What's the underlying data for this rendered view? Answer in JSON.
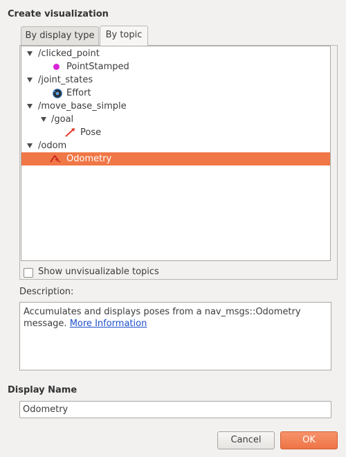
{
  "dialog": {
    "title": "Create visualization"
  },
  "tabs": [
    {
      "label": "By display type",
      "active": false
    },
    {
      "label": "By topic",
      "active": true
    }
  ],
  "tree": {
    "items": [
      {
        "label": "/clicked_point"
      },
      {
        "label": "PointStamped",
        "icon": "magenta-dot-icon"
      },
      {
        "label": "/joint_states"
      },
      {
        "label": "Effort",
        "icon": "effort-gauge-icon"
      },
      {
        "label": "/move_base_simple"
      },
      {
        "label": "/goal"
      },
      {
        "label": "Pose",
        "icon": "pose-arrow-icon"
      },
      {
        "label": "/odom"
      },
      {
        "label": "Odometry",
        "icon": "odometry-icon",
        "selected": true
      }
    ]
  },
  "options": {
    "show_unvisualizable_label": "Show unvisualizable topics",
    "show_unvisualizable_checked": false
  },
  "description": {
    "heading": "Description:",
    "text": "Accumulates and displays poses from a nav_msgs::Odometry message.",
    "link": "More Information"
  },
  "display_name": {
    "heading": "Display Name",
    "value": "Odometry"
  },
  "buttons": {
    "cancel_label": "Cancel",
    "ok_label": "OK"
  },
  "colors": {
    "selection": "#f07746",
    "ok_button": "#ee7446",
    "link": "#1c4fc9"
  }
}
